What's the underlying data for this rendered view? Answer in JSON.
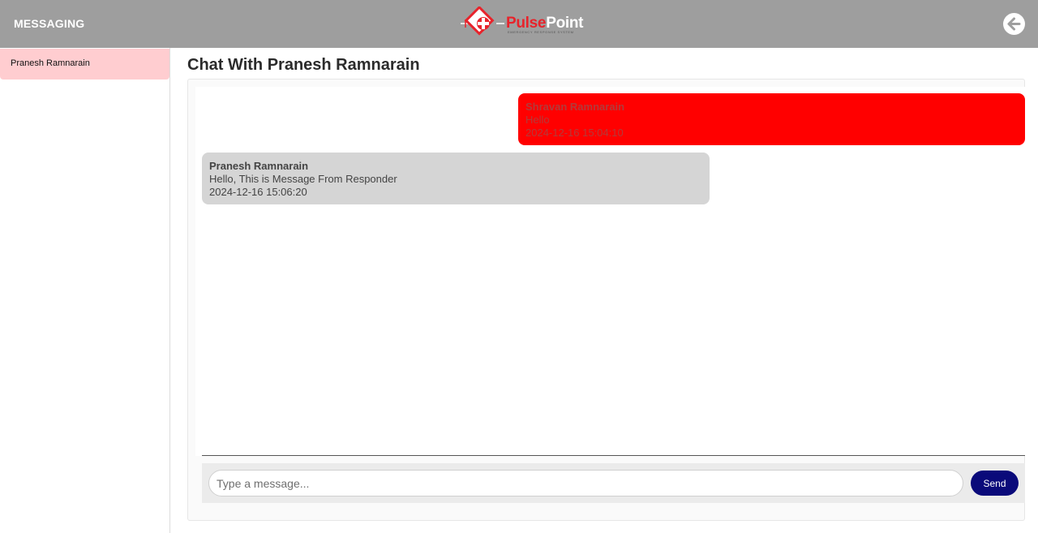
{
  "header": {
    "title": "MESSAGING",
    "logo": {
      "brand_part1": "Pulse",
      "brand_part2": "Point",
      "tagline": "EMERGENCY RESPONSE SYSTEM"
    },
    "back_icon": "arrow-left-icon"
  },
  "sidebar": {
    "contacts": [
      {
        "name": "Pranesh Ramnarain"
      }
    ]
  },
  "chat": {
    "title": "Chat With Pranesh Ramnarain",
    "messages": [
      {
        "sender": "Shravan Ramnarain",
        "text": "Hello",
        "timestamp": "2024-12-16 15:04:10",
        "direction": "sent"
      },
      {
        "sender": "Pranesh Ramnarain",
        "text": "Hello, This is Message From Responder",
        "timestamp": "2024-12-16 15:06:20",
        "direction": "received"
      }
    ],
    "composer": {
      "placeholder": "Type a message...",
      "value": "",
      "send_label": "Send"
    }
  },
  "colors": {
    "header_bg": "#9e9e9e",
    "active_contact_bg": "#ffcdd0",
    "sent_bubble": "#ff0000",
    "received_bubble": "#d5d5d5",
    "send_button": "#0a0a7a"
  }
}
